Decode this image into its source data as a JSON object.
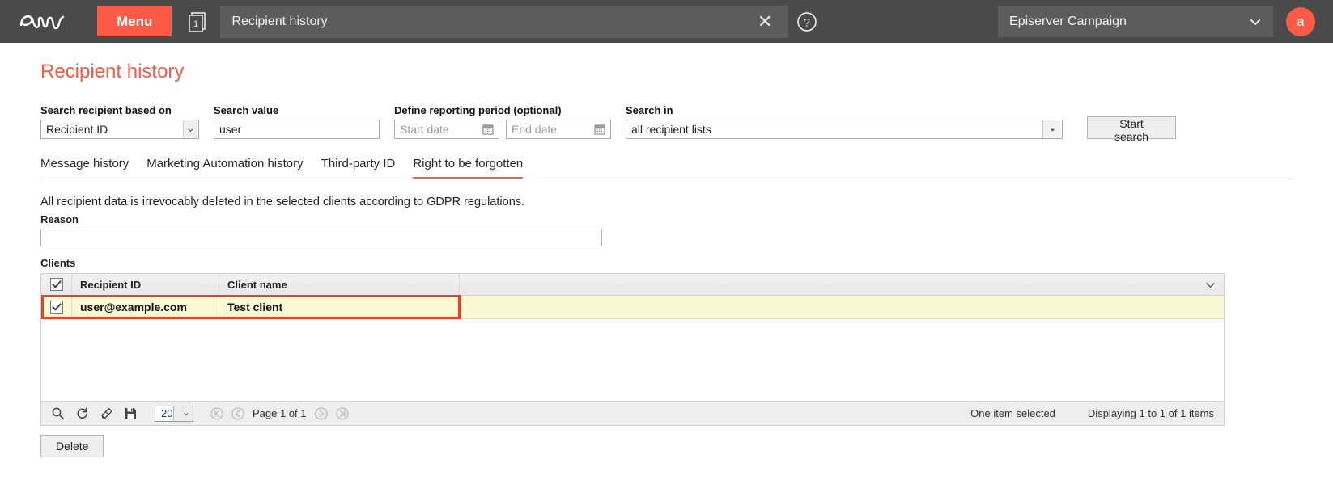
{
  "topbar": {
    "logo_name": "episerver-logo",
    "menu_label": "Menu",
    "doc_badge": "1",
    "breadcrumb": "Recipient history",
    "close_label": "✕",
    "help_label": "?",
    "client_selector": "Episerver Campaign",
    "avatar_initial": "a"
  },
  "page": {
    "title": "Recipient history"
  },
  "search": {
    "based_on_label": "Search recipient based on",
    "based_on_value": "Recipient ID",
    "value_label": "Search value",
    "value_value": "user",
    "value_placeholder": "",
    "period_label": "Define reporting period (optional)",
    "start_date_placeholder": "Start date",
    "start_date_value": "",
    "end_date_placeholder": "End date",
    "end_date_value": "",
    "search_in_label": "Search in",
    "search_in_value": "all recipient lists",
    "start_button": "Start search"
  },
  "tabs": [
    {
      "label": "Message history",
      "active": false
    },
    {
      "label": "Marketing Automation history",
      "active": false
    },
    {
      "label": "Third-party ID",
      "active": false
    },
    {
      "label": "Right to be forgotten",
      "active": true
    }
  ],
  "panel": {
    "gdpr_note": "All recipient data is irrevocably deleted in the selected clients according to GDPR regulations.",
    "reason_label": "Reason",
    "reason_value": "",
    "reason_placeholder": "",
    "clients_label": "Clients"
  },
  "grid": {
    "columns": [
      "Recipient ID",
      "Client name"
    ],
    "rows": [
      {
        "recipient_id": "user@example.com",
        "client_name": "Test client",
        "selected": true,
        "highlighted": true
      }
    ],
    "header_menu_icon": "chevron-down-icon"
  },
  "grid_toolbar": {
    "icons": [
      "search-icon",
      "refresh-icon",
      "eraser-icon",
      "save-icon"
    ],
    "page_size": "20",
    "first_page_icon": "first-page-icon",
    "prev_page_icon": "prev-page-icon",
    "page_text": "Page 1 of 1",
    "next_page_icon": "next-page-icon",
    "last_page_icon": "last-page-icon",
    "selection_status": "One item selected",
    "display_status": "Displaying 1 to 1 of 1 items"
  },
  "actions": {
    "delete_label": "Delete"
  },
  "colors": {
    "accent": "#fa5a46",
    "topbar_bg": "#4a4a4a",
    "highlight_border": "#f03c22",
    "row_bg": "#fbf8d4"
  }
}
